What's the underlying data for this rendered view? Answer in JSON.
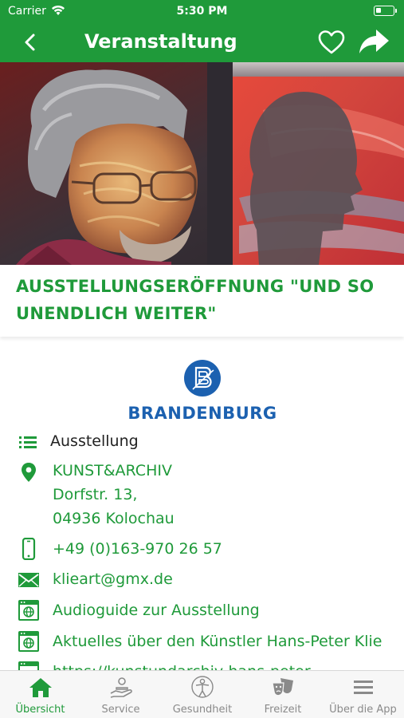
{
  "status_bar": {
    "carrier": "Carrier",
    "time": "5:30 PM"
  },
  "nav": {
    "title": "Veranstaltung",
    "back_icon": "chevron-left-icon",
    "favorite_icon": "heart-outline-icon",
    "share_icon": "share-arrow-icon"
  },
  "event": {
    "title": "AUSSTELLUNGSERÖFFNUNG \"UND SO UNENDLICH WEITER\"",
    "organizer_logo_text": "BRANDENBURG",
    "category": "Ausstellung",
    "location": {
      "name": "KUNST&ARCHIV",
      "street": "Dorfstr. 13,",
      "city": "04936 Kolochau"
    },
    "phone": "+49 (0)163-970 26 57",
    "email": "klieart@gmx.de",
    "links": [
      "Audioguide zur Ausstellung",
      "Aktuelles über den Künstler Hans-Peter Klie",
      "https://kunstundarchiv-hans-peter"
    ]
  },
  "tab_bar": {
    "items": [
      {
        "label": "Übersicht",
        "icon": "home-icon",
        "active": true
      },
      {
        "label": "Service",
        "icon": "service-hand-icon",
        "active": false
      },
      {
        "label": "Gesundheit",
        "icon": "health-figure-icon",
        "active": false
      },
      {
        "label": "Freizeit",
        "icon": "theater-masks-icon",
        "active": false
      },
      {
        "label": "Über die App",
        "icon": "menu-lines-icon",
        "active": false
      }
    ]
  },
  "colors": {
    "brand_green": "#1f9a3a",
    "logo_blue": "#1c61b0",
    "inactive_tab": "#8a8a8a"
  }
}
